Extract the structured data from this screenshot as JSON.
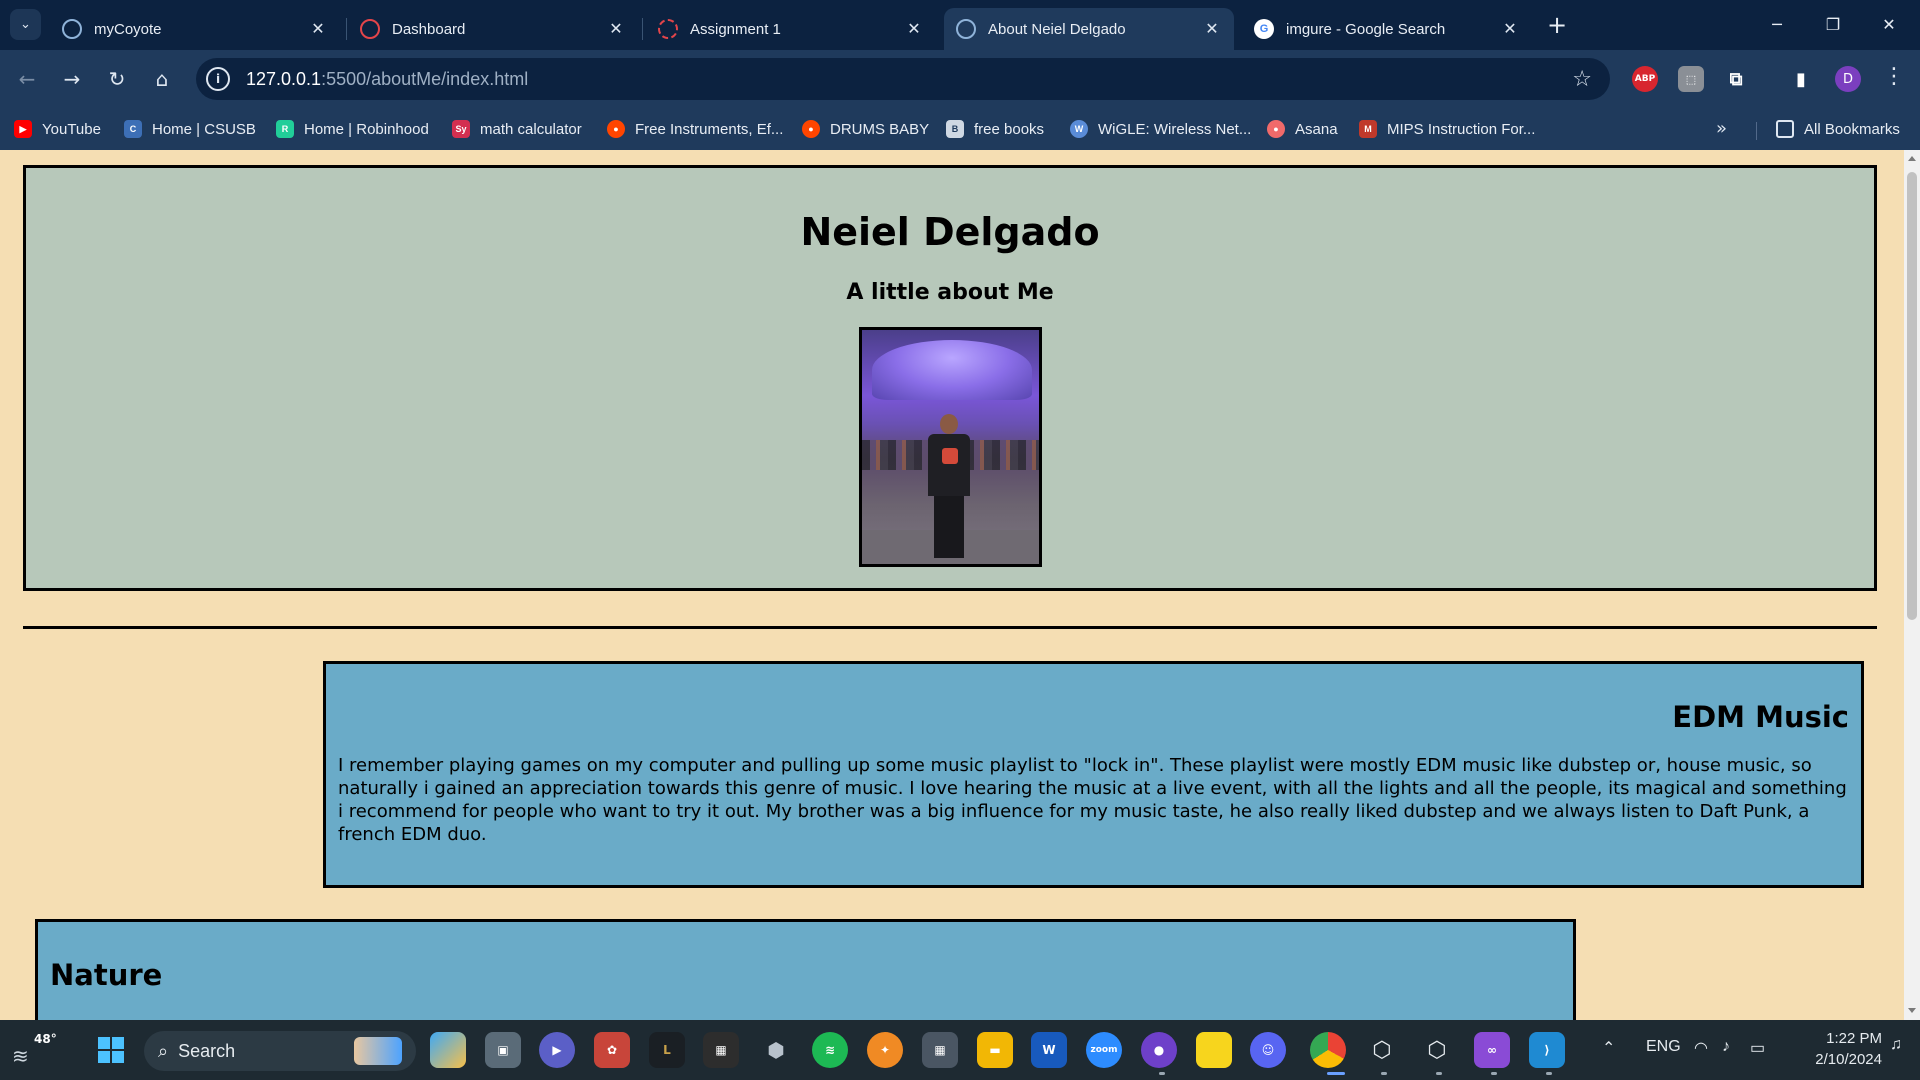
{
  "browser": {
    "tabs": [
      {
        "title": "myCoyote",
        "favicon": "globe-icon",
        "color": "#8fb3d9"
      },
      {
        "title": "Dashboard",
        "favicon": "canvas-icon",
        "color": "#e3454a"
      },
      {
        "title": "Assignment 1",
        "favicon": "canvas-icon",
        "color": "#e3454a"
      },
      {
        "title": "About Neiel Delgado",
        "favicon": "globe-icon",
        "color": "#8fb3d9",
        "active": true
      },
      {
        "title": "imgure - Google Search",
        "favicon": "google-icon",
        "color": "#ffffff"
      }
    ],
    "url_host": "127.0.0.1",
    "url_path": ":5500/aboutMe/index.html",
    "profile_initial": "D",
    "extension_abp": "ABP",
    "bookmarks": [
      {
        "label": "YouTube",
        "icon": "youtube-icon",
        "color": "#ff0000"
      },
      {
        "label": "Home | CSUSB",
        "icon": "csusb-icon",
        "color": "#3d6fb6"
      },
      {
        "label": "Home | Robinhood",
        "icon": "robinhood-icon",
        "color": "#21ce99"
      },
      {
        "label": "math calculator",
        "icon": "symbolab-icon",
        "color": "#d32f50"
      },
      {
        "label": "Free Instruments, Ef...",
        "icon": "reddit-icon",
        "color": "#ff4500"
      },
      {
        "label": "DRUMS BABY",
        "icon": "reddit-icon",
        "color": "#ff4500"
      },
      {
        "label": "free books",
        "icon": "book-icon",
        "color": "#cfd8e3"
      },
      {
        "label": "WiGLE: Wireless Net...",
        "icon": "wigle-icon",
        "color": "#5a8cd8"
      },
      {
        "label": "Asana",
        "icon": "asana-icon",
        "color": "#f06a6a"
      },
      {
        "label": "MIPS Instruction For...",
        "icon": "mips-icon",
        "color": "#c0392b"
      }
    ],
    "all_bookmarks": "All Bookmarks"
  },
  "page": {
    "name": "Neiel Delgado",
    "subtitle": "A little about Me",
    "sections": [
      {
        "heading": "EDM Music",
        "body": "I remember playing games on my computer and pulling up some music playlist to \"lock in\". These playlist were mostly EDM music like dubstep or, house music, so naturally i gained an appreciation towards this genre of music. I love hearing the music at a live event, with all the lights and all the people, its magical and something i recommend for people who want to try it out. My brother was a big influence for my music taste, he also really liked dubstep and we always listen to Daft Punk, a french EDM duo."
      },
      {
        "heading": "Nature",
        "body": ""
      }
    ],
    "colors": {
      "background": "#f5deb3",
      "header_box": "#b7c8ba",
      "section_box": "#6aabc8"
    }
  },
  "taskbar": {
    "weather_temp": "48°",
    "search_label": "Search",
    "tray_language": "ENG",
    "time": "1:22 PM",
    "date": "2/10/2024"
  }
}
